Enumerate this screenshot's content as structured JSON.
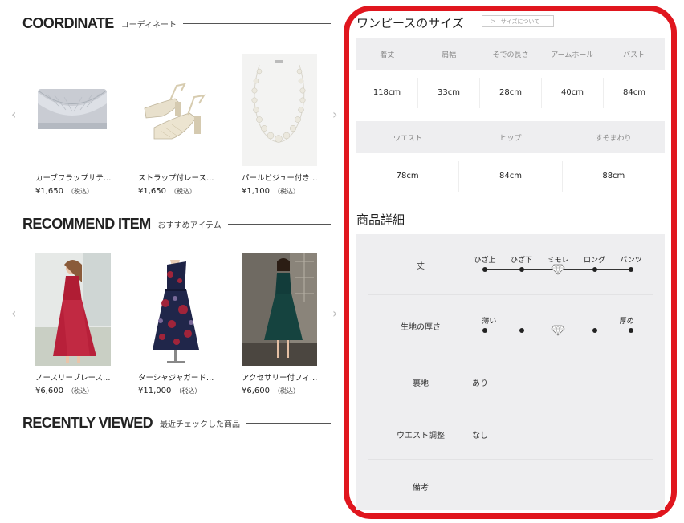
{
  "coordinate": {
    "title_en": "COORDINATE",
    "title_ja": "コーディネート",
    "items": [
      {
        "name": "カーブフラップサテ…",
        "price": "¥1,650",
        "tax": "（税込）"
      },
      {
        "name": "ストラップ付レース…",
        "price": "¥1,650",
        "tax": "（税込）"
      },
      {
        "name": "パールビジュー付き…",
        "price": "¥1,100",
        "tax": "（税込）"
      }
    ]
  },
  "recommend": {
    "title_en": "RECOMMEND ITEM",
    "title_ja": "おすすめアイテム",
    "items": [
      {
        "name": "ノースリーブレース…",
        "price": "¥6,600",
        "tax": "（税込）"
      },
      {
        "name": "ターシャジャガード…",
        "price": "¥11,000",
        "tax": "（税込）"
      },
      {
        "name": "アクセサリー付フィ…",
        "price": "¥6,600",
        "tax": "（税込）"
      }
    ]
  },
  "recent": {
    "title_en": "RECENTLY VIEWED",
    "title_ja": "最近チェックした商品"
  },
  "arrows": {
    "prev": "‹",
    "next": "›"
  },
  "size": {
    "title": "ワンピースのサイズ",
    "link_label": "サイズについて",
    "row1_headers": [
      "着丈",
      "肩幅",
      "そでの長さ",
      "アームホール",
      "バスト"
    ],
    "row1_values": [
      "118cm",
      "33cm",
      "28cm",
      "40cm",
      "84cm"
    ],
    "row2_headers": [
      "ウエスト",
      "ヒップ",
      "すそまわり"
    ],
    "row2_values": [
      "78cm",
      "84cm",
      "88cm"
    ]
  },
  "detail": {
    "title": "商品詳細",
    "length": {
      "label": "丈",
      "options": [
        "ひざ上",
        "ひざ下",
        "ミモレ",
        "ロング",
        "パンツ"
      ],
      "selected_index": 2
    },
    "thickness": {
      "label": "生地の厚さ",
      "min_label": "薄い",
      "max_label": "厚め",
      "positions": 5,
      "selected_index": 2
    },
    "lining": {
      "label": "裏地",
      "value": "あり"
    },
    "waist": {
      "label": "ウエスト調整",
      "value": "なし"
    },
    "note": {
      "label": "備考",
      "value": ""
    }
  },
  "colors": {
    "accent_frame": "#e0161e",
    "panel_bg": "#eeeef0"
  }
}
